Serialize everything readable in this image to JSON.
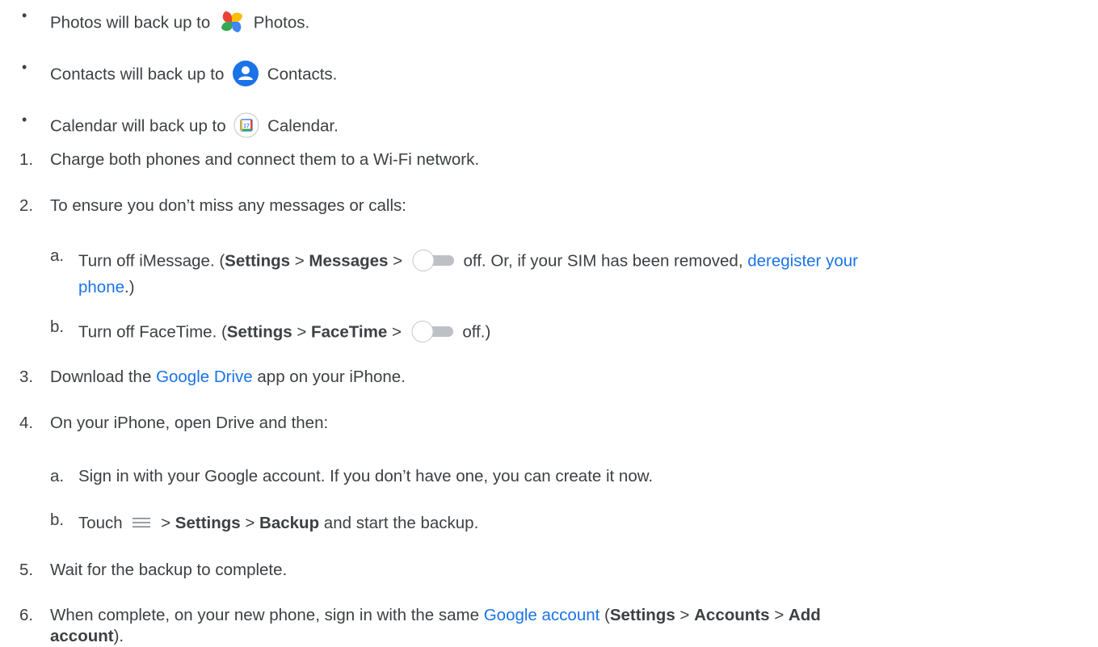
{
  "bullets": [
    {
      "before": "Photos will back up to",
      "icon": "google-photos-icon",
      "after": "Photos."
    },
    {
      "before": "Contacts will back up to",
      "icon": "google-contacts-icon",
      "after": "Contacts."
    },
    {
      "before": "Calendar will back up to",
      "icon": "google-calendar-icon",
      "calendar_number": "17",
      "after": "Calendar."
    }
  ],
  "steps": {
    "s1": {
      "num": "1.",
      "text": "Charge both phones and connect them to a Wi-Fi network."
    },
    "s2": {
      "num": "2.",
      "text": "To ensure you don’t miss any messages or calls:",
      "a": {
        "letter": "a.",
        "t1": "Turn off iMessage. (",
        "b1": "Settings",
        "t2": " > ",
        "b2": "Messages",
        "t3": " > ",
        "t4": " off. Or, if your SIM has been removed, ",
        "link_part1": "deregister your",
        "link_part2": "phone",
        "t5": ".)"
      },
      "b": {
        "letter": "b.",
        "t1": "Turn off FaceTime. (",
        "b1": "Settings",
        "t2": " > ",
        "b2": "FaceTime",
        "t3": " > ",
        "t4": " off.)"
      }
    },
    "s3": {
      "num": "3.",
      "t1": "Download the ",
      "link": "Google Drive",
      "t2": " app on your iPhone."
    },
    "s4": {
      "num": "4.",
      "text": "On your iPhone, open Drive and then:",
      "a": {
        "letter": "a.",
        "text": "Sign in with your Google account. If you don’t have one, you can create it now."
      },
      "b": {
        "letter": "b.",
        "t1": "Touch",
        "t2": " > ",
        "b1": "Settings",
        "t3": " > ",
        "b2": "Backup",
        "t4": " and start the backup."
      }
    },
    "s5": {
      "num": "5.",
      "text": "Wait for the backup to complete."
    },
    "s6": {
      "num": "6.",
      "t1": "When complete, on your new phone, sign in with the same ",
      "link": "Google account",
      "t2": " (",
      "b1": "Settings",
      "t3": " > ",
      "b2": "Accounts",
      "t4": " > ",
      "b3": "Add",
      "b4": "account",
      "t5": ")."
    }
  },
  "colors": {
    "text": "#3c4043",
    "link": "#1a73e8",
    "toggle_track": "#bdc1c6"
  }
}
